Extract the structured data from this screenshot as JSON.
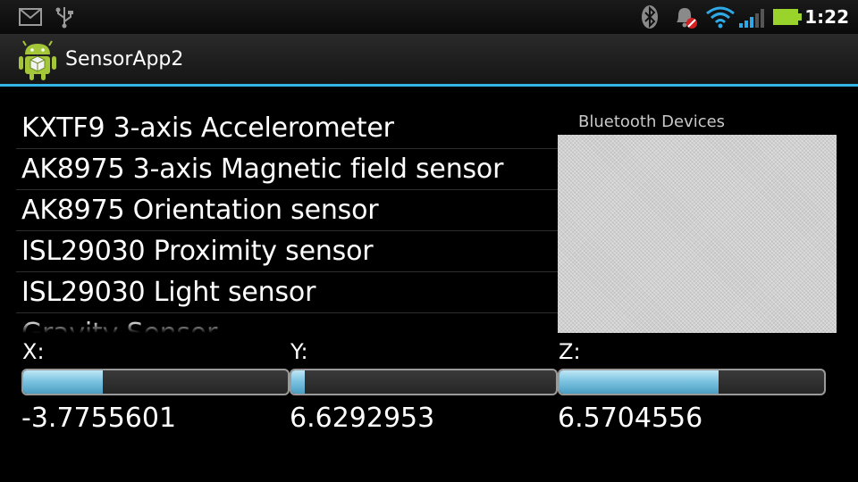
{
  "status_bar": {
    "time": "1:22",
    "icons": [
      "gmail-icon",
      "usb-icon",
      "bluetooth-icon",
      "alarm-muted-icon",
      "wifi-icon",
      "signal-icon",
      "battery-icon"
    ]
  },
  "app": {
    "title": "SensorApp2"
  },
  "sensors": [
    "KXTF9 3-axis Accelerometer",
    "AK8975 3-axis Magnetic field sensor",
    "AK8975 Orientation sensor",
    "ISL29030 Proximity sensor",
    "ISL29030 Light sensor",
    "Gravity Sensor"
  ],
  "bluetooth": {
    "label": "Bluetooth Devices"
  },
  "axes": [
    {
      "label": "X:",
      "value": "-3.7755601",
      "level_pct": 30
    },
    {
      "label": "Y:",
      "value": "6.6292953",
      "level_pct": 5
    },
    {
      "label": "Z:",
      "value": "6.5704556",
      "level_pct": 60
    }
  ],
  "colors": {
    "accent": "#33b5e5",
    "bar_fill": "#7ec4e2",
    "battery": "#9bd32d"
  }
}
